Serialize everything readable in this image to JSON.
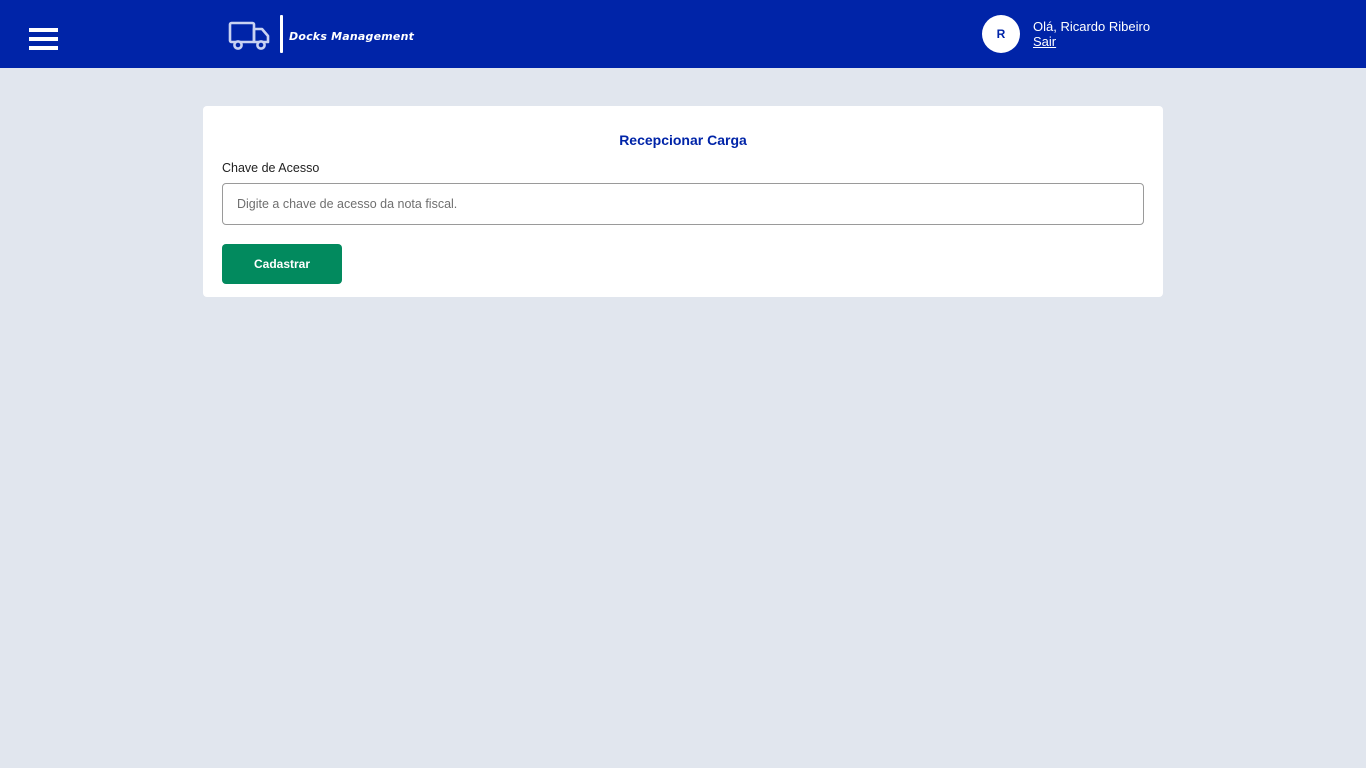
{
  "header": {
    "menu_icon": "hamburger-menu-icon",
    "brand": {
      "icon": "truck-icon",
      "name": "Docks Management"
    },
    "user": {
      "avatar_initial": "R",
      "greeting": "Olá, Ricardo Ribeiro",
      "logout_label": "Sair"
    },
    "colors": {
      "background": "#0024a8",
      "foreground": "#ffffff"
    }
  },
  "main": {
    "card": {
      "title": "Recepcionar Carga",
      "access_key": {
        "label": "Chave de Acesso",
        "value": "",
        "placeholder": "Digite a chave de acesso da nota fiscal."
      },
      "submit_label": "Cadastrar"
    },
    "colors": {
      "page_background": "#e1e6ee",
      "title": "#0024a8",
      "submit_button": "#028a5e"
    }
  }
}
